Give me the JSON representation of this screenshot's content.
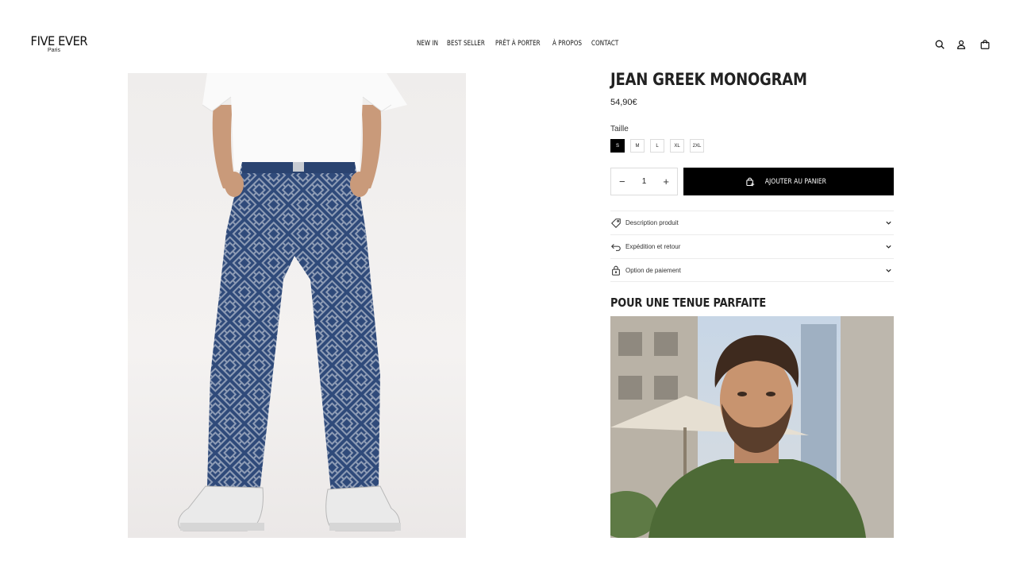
{
  "brand": {
    "name": "FIVE EVER",
    "sub": "Paris"
  },
  "nav": [
    "NEW IN",
    "BEST SELLER",
    "PRÊT À PORTER",
    "À PROPOS",
    "CONTACT"
  ],
  "header_icons": [
    "search-icon",
    "account-icon",
    "bag-icon"
  ],
  "product": {
    "title": "JEAN GREEK MONOGRAM",
    "price": "54,90€",
    "size_label": "Taille",
    "sizes": [
      "S",
      "M",
      "L",
      "XL",
      "2XL"
    ],
    "selected_size": "S",
    "quantity": "1",
    "add_to_cart": "AJOUTER AU PANIER",
    "accordion": [
      {
        "label": "Description produit",
        "icon": "tag-icon"
      },
      {
        "label": "Expédition et retour",
        "icon": "return-icon"
      },
      {
        "label": "Option de paiement",
        "icon": "lock-icon"
      }
    ]
  },
  "outfit": {
    "title": "POUR UNE TENUE PARFAITE"
  },
  "colors": {
    "accent": "#000000",
    "denim": "#2f4a7a",
    "border": "#dcdcdc"
  }
}
